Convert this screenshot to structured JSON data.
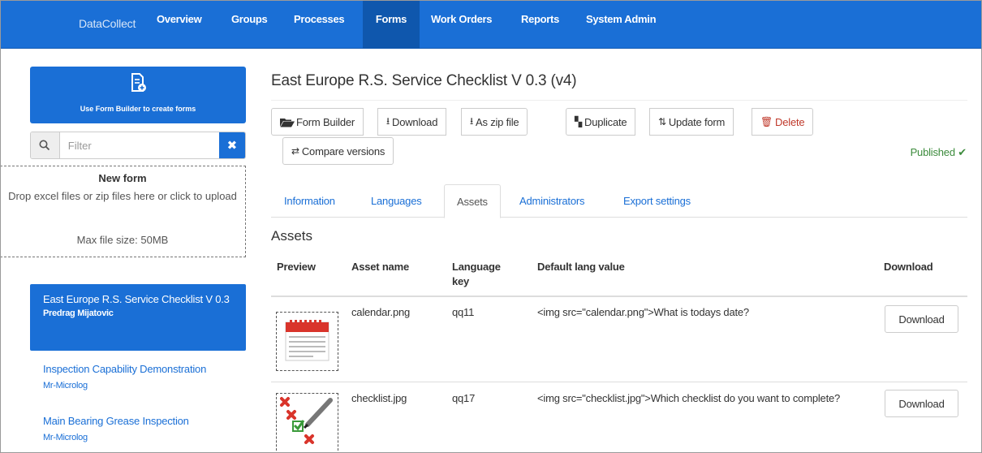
{
  "navbar": {
    "brand": "DataCollect",
    "items": [
      "Overview",
      "Groups",
      "Processes",
      "Forms",
      "Work Orders",
      "Reports",
      "System Admin"
    ],
    "active": "Forms"
  },
  "sidebar": {
    "form_builder_label": "Use Form Builder to create forms",
    "filter_placeholder": "Filter",
    "dropzone": {
      "title": "New form",
      "text": "Drop excel files or zip files here or click to upload",
      "max_size": "Max file size: 50MB"
    },
    "forms": [
      {
        "title": "East Europe R.S. Service Checklist V 0.3",
        "author": "Predrag Mijatovic",
        "active": true
      },
      {
        "title": "Inspection Capability Demonstration",
        "author": "Mr-Microlog",
        "active": false
      },
      {
        "title": "Main Bearing Grease Inspection",
        "author": "Mr-Microlog",
        "active": false
      }
    ]
  },
  "main": {
    "title": "East Europe R.S. Service Checklist V 0.3 (v4)",
    "toolbar": {
      "form_builder": "Form Builder",
      "download": "Download",
      "zip": "As zip file",
      "duplicate": "Duplicate",
      "update": "Update form",
      "delete": "Delete",
      "compare": "Compare versions"
    },
    "status": "Published",
    "tabs": [
      "Information",
      "Languages",
      "Assets",
      "Administrators",
      "Export settings"
    ],
    "active_tab": "Assets",
    "assets": {
      "heading": "Assets",
      "columns": [
        "Preview",
        "Asset name",
        "Language key",
        "Default lang value",
        "Download"
      ],
      "rows": [
        {
          "name": "calendar.png",
          "key": "qq11",
          "value": "<img src=\"calendar.png\">What is todays date?",
          "download": "Download"
        },
        {
          "name": "checklist.jpg",
          "key": "qq17",
          "value": "<img src=\"checklist.jpg\">Which checklist do you want to complete?",
          "download": "Download"
        }
      ]
    }
  },
  "colors": {
    "primary": "#1a6fd6",
    "primary_dark": "#0f57ad",
    "success": "#3c8b3c",
    "danger": "#c0392b"
  }
}
